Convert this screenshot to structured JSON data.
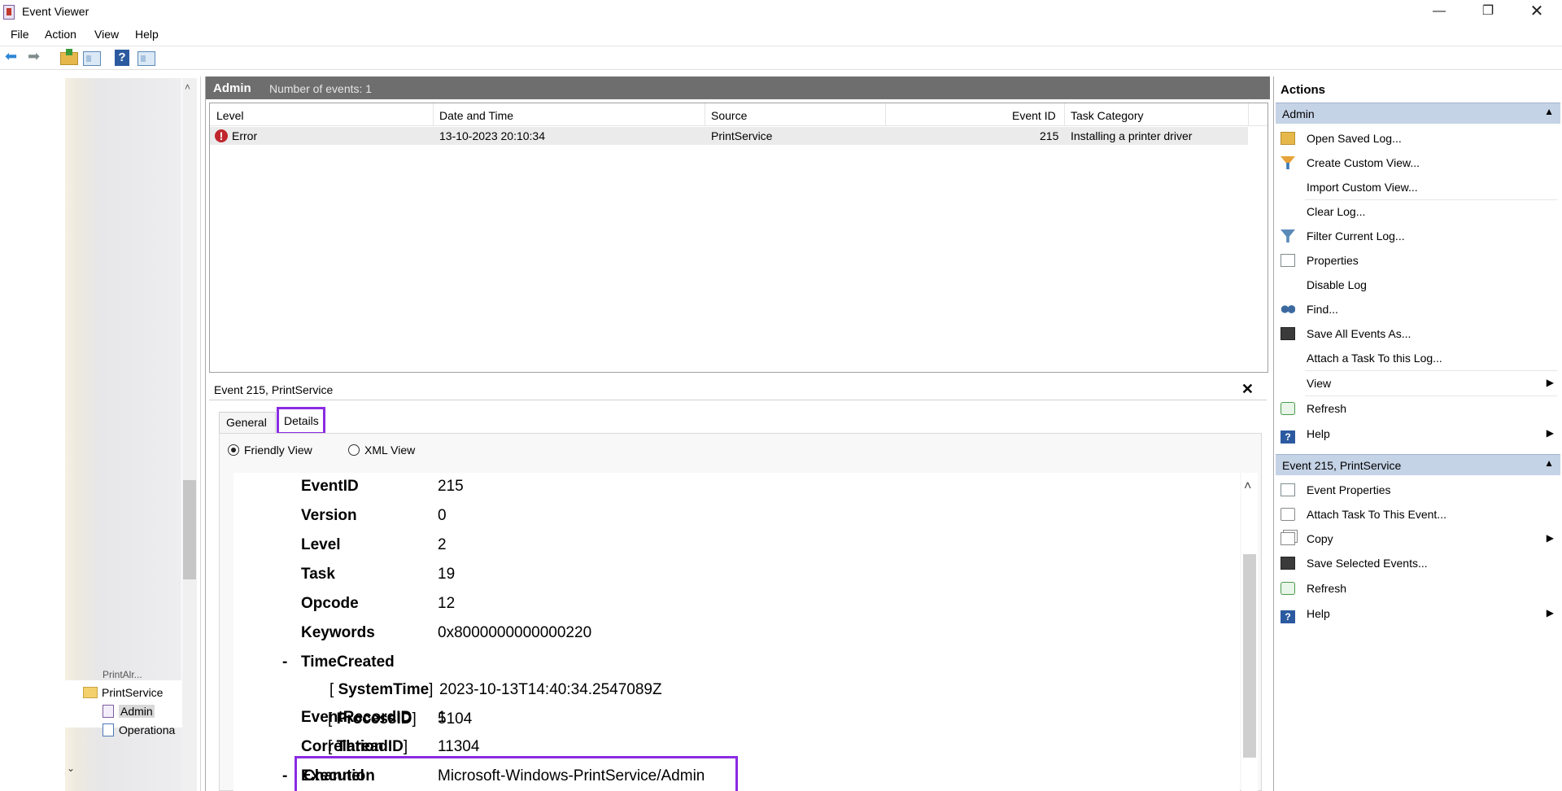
{
  "window": {
    "title": "Event Viewer",
    "minimize": "—",
    "maximize": "❐",
    "close": "✕"
  },
  "menu": [
    "File",
    "Action",
    "View",
    "Help"
  ],
  "tree": {
    "partial_item": "PrintAlr...",
    "printservice": "PrintService",
    "admin": "Admin",
    "operational": "Operationa"
  },
  "list": {
    "name": "Admin",
    "count": "Number of events: 1",
    "columns": [
      "Level",
      "Date and Time",
      "Source",
      "Event ID",
      "Task Category"
    ],
    "row": {
      "level": "Error",
      "datetime": "13-10-2023 20:10:34",
      "source": "PrintService",
      "event_id": "215",
      "category": "Installing a printer driver"
    }
  },
  "detail": {
    "title": "Event 215, PrintService",
    "close": "✕",
    "tabs": {
      "general": "General",
      "details": "Details"
    },
    "view_options": {
      "friendly": "Friendly View",
      "xml": "XML View"
    },
    "fields": {
      "eventid_k": "EventID",
      "eventid_v": "215",
      "version_k": "Version",
      "version_v": "0",
      "level_k": "Level",
      "level_v": "2",
      "task_k": "Task",
      "task_v": "19",
      "opcode_k": "Opcode",
      "opcode_v": "12",
      "keywords_k": "Keywords",
      "keywords_v": "0x8000000000000220",
      "timecreated_k": "TimeCreated",
      "systemtime_k": "SystemTime",
      "systemtime_v": "2023-10-13T14:40:34.2547089Z",
      "recordid_k": "EventRecordID",
      "recordid_v": "1",
      "correlation_k": "Correlation",
      "execution_k": "Execution",
      "processid_k": "ProcessID",
      "processid_v": "5104",
      "threadid_k": "ThreadID",
      "threadid_v": "11304",
      "channel_k": "Channel",
      "channel_v": "Microsoft-Windows-PrintService/Admin"
    }
  },
  "actions": {
    "title": "Actions",
    "section1": "Admin",
    "items1": [
      "Open Saved Log...",
      "Create Custom View...",
      "Import Custom View...",
      "Clear Log...",
      "Filter Current Log...",
      "Properties",
      "Disable Log",
      "Find...",
      "Save All Events As...",
      "Attach a Task To this Log...",
      "View",
      "Refresh",
      "Help"
    ],
    "section2": "Event 215, PrintService",
    "items2": [
      "Event Properties",
      "Attach Task To This Event...",
      "Copy",
      "Save Selected Events...",
      "Refresh",
      "Help"
    ]
  },
  "icons": {
    "back": "back-arrow-icon",
    "forward": "forward-arrow-icon",
    "error": "error-icon",
    "accent_highlight": "#8a2be2",
    "header_gray": "#6e6e6e",
    "section_blue": "#c5d3e6"
  }
}
